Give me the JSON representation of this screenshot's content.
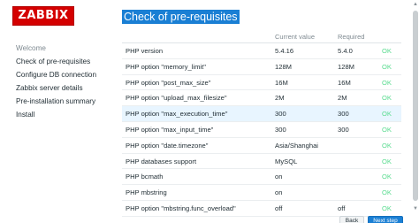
{
  "logo": {
    "text": "ZABBIX"
  },
  "sidebar": {
    "items": [
      {
        "label": "Welcome"
      },
      {
        "label": "Check of pre-requisites"
      },
      {
        "label": "Configure DB connection"
      },
      {
        "label": "Zabbix server details"
      },
      {
        "label": "Pre-installation summary"
      },
      {
        "label": "Install"
      }
    ]
  },
  "page_title": "Check of pre-requisites",
  "table": {
    "headers": {
      "name": "",
      "current": "Current value",
      "required": "Required",
      "result": ""
    },
    "rows": [
      {
        "name": "PHP version",
        "current": "5.4.16",
        "required": "5.4.0",
        "result": "OK"
      },
      {
        "name": "PHP option \"memory_limit\"",
        "current": "128M",
        "required": "128M",
        "result": "OK"
      },
      {
        "name": "PHP option \"post_max_size\"",
        "current": "16M",
        "required": "16M",
        "result": "OK"
      },
      {
        "name": "PHP option \"upload_max_filesize\"",
        "current": "2M",
        "required": "2M",
        "result": "OK"
      },
      {
        "name": "PHP option \"max_execution_time\"",
        "current": "300",
        "required": "300",
        "result": "OK"
      },
      {
        "name": "PHP option \"max_input_time\"",
        "current": "300",
        "required": "300",
        "result": "OK"
      },
      {
        "name": "PHP option \"date.timezone\"",
        "current": "Asia/Shanghai",
        "required": "",
        "result": "OK"
      },
      {
        "name": "PHP databases support",
        "current": "MySQL",
        "required": "",
        "result": "OK"
      },
      {
        "name": "PHP bcmath",
        "current": "on",
        "required": "",
        "result": "OK"
      },
      {
        "name": "PHP mbstring",
        "current": "on",
        "required": "",
        "result": "OK"
      },
      {
        "name": "PHP option \"mbstring.func_overload\"",
        "current": "off",
        "required": "off",
        "result": "OK"
      }
    ]
  },
  "footer": {
    "back_label": "Back",
    "next_label": "Next step"
  },
  "colors": {
    "brand_red": "#d40000",
    "accent_blue": "#1a7fd4",
    "ok_green": "#59db8f",
    "row_highlight": "#e8f5ff"
  }
}
